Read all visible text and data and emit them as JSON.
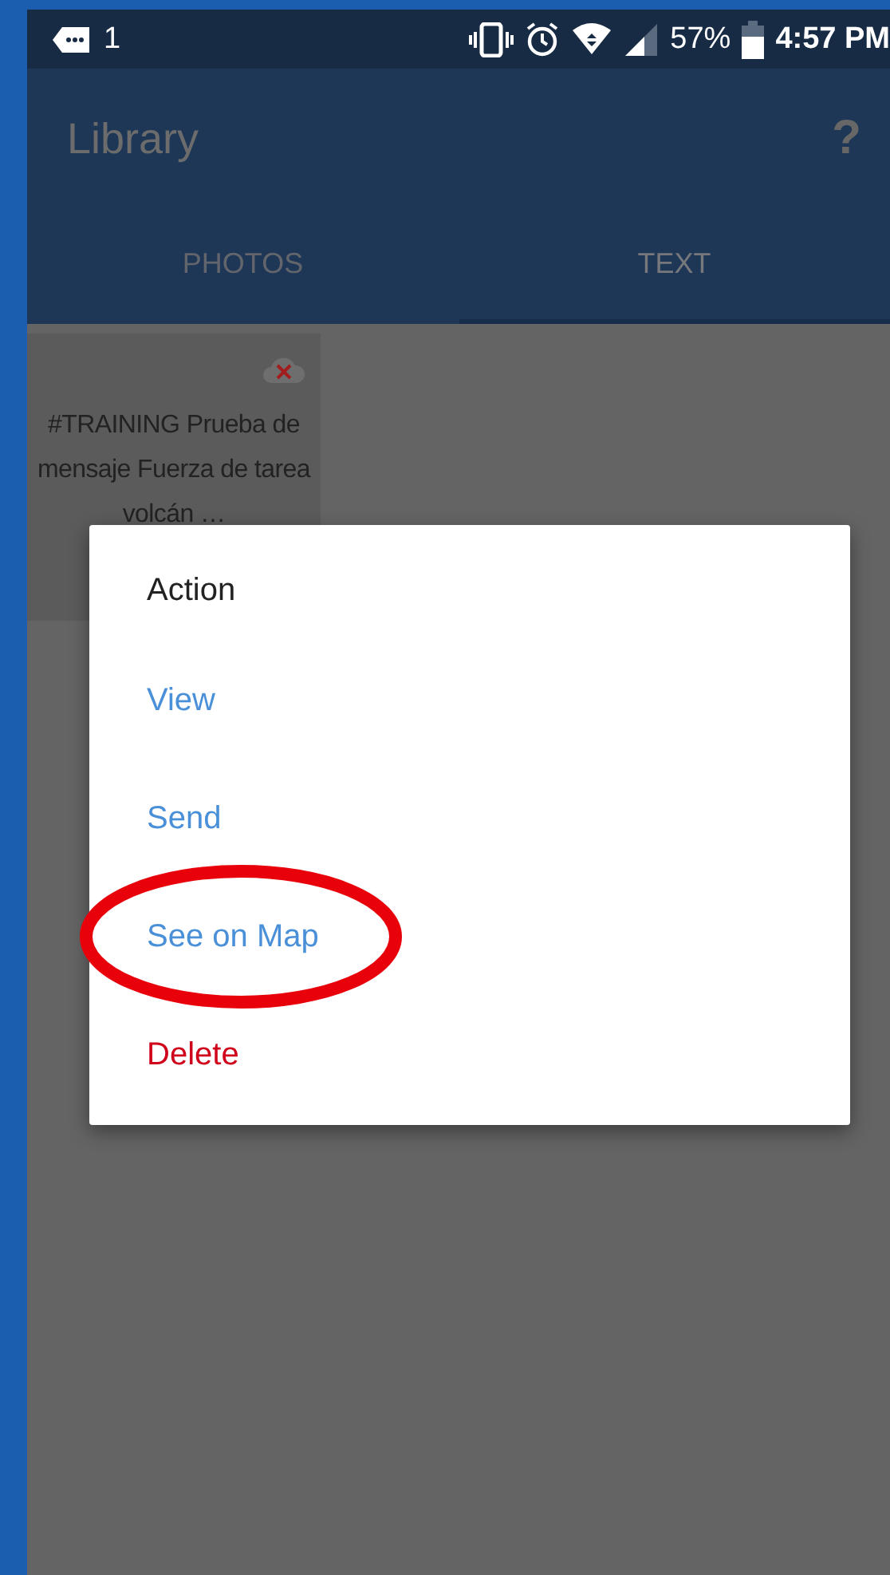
{
  "status_bar": {
    "notification_count": "1",
    "battery": "57%",
    "time": "4:57 PM"
  },
  "app_bar": {
    "title": "Library",
    "help": "?"
  },
  "tabs": [
    {
      "label": "PHOTOS",
      "selected": false
    },
    {
      "label": "TEXT",
      "selected": true
    }
  ],
  "cards": [
    {
      "text": "#TRAINING Prueba de mensaje Fuerza de tarea volcán …"
    }
  ],
  "dialog": {
    "title": "Action",
    "items": [
      {
        "label": "View",
        "kind": "normal",
        "highlighted": false
      },
      {
        "label": "Send",
        "kind": "normal",
        "highlighted": false
      },
      {
        "label": "See on Map",
        "kind": "normal",
        "highlighted": true
      },
      {
        "label": "Delete",
        "kind": "destructive",
        "highlighted": false
      }
    ]
  }
}
